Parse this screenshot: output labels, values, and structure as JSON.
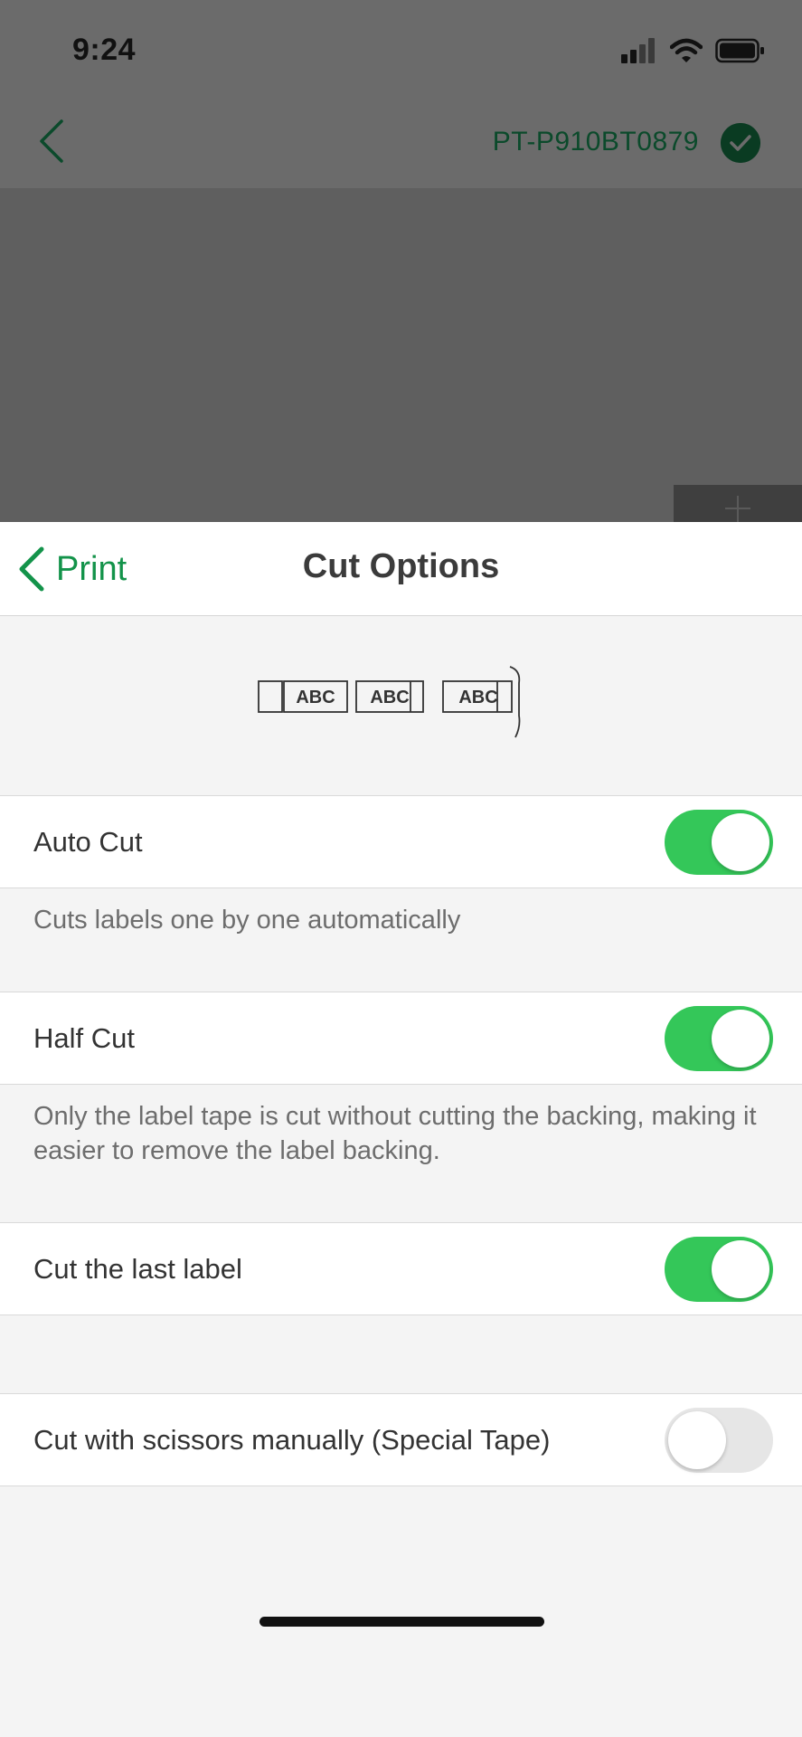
{
  "status_bar": {
    "time": "9:24"
  },
  "background_screen": {
    "printer_name": "PT-P910BT0879"
  },
  "nav": {
    "back_label": "Print",
    "title": "Cut Options"
  },
  "diagram": {
    "labels": [
      "ABC",
      "ABC",
      "ABC"
    ]
  },
  "options": [
    {
      "label": "Auto Cut",
      "enabled": true,
      "description": "Cuts labels one by one automatically"
    },
    {
      "label": "Half Cut",
      "enabled": true,
      "description": "Only the label tape is cut without cutting the backing, making it easier to remove the label backing."
    },
    {
      "label": "Cut the last label",
      "enabled": true,
      "description": ""
    },
    {
      "label": "Cut with scissors manually (Special Tape)",
      "enabled": false,
      "description": ""
    }
  ],
  "colors": {
    "accent": "#13934a",
    "toggle_on": "#34c759",
    "toggle_off": "#e6e6e6"
  }
}
